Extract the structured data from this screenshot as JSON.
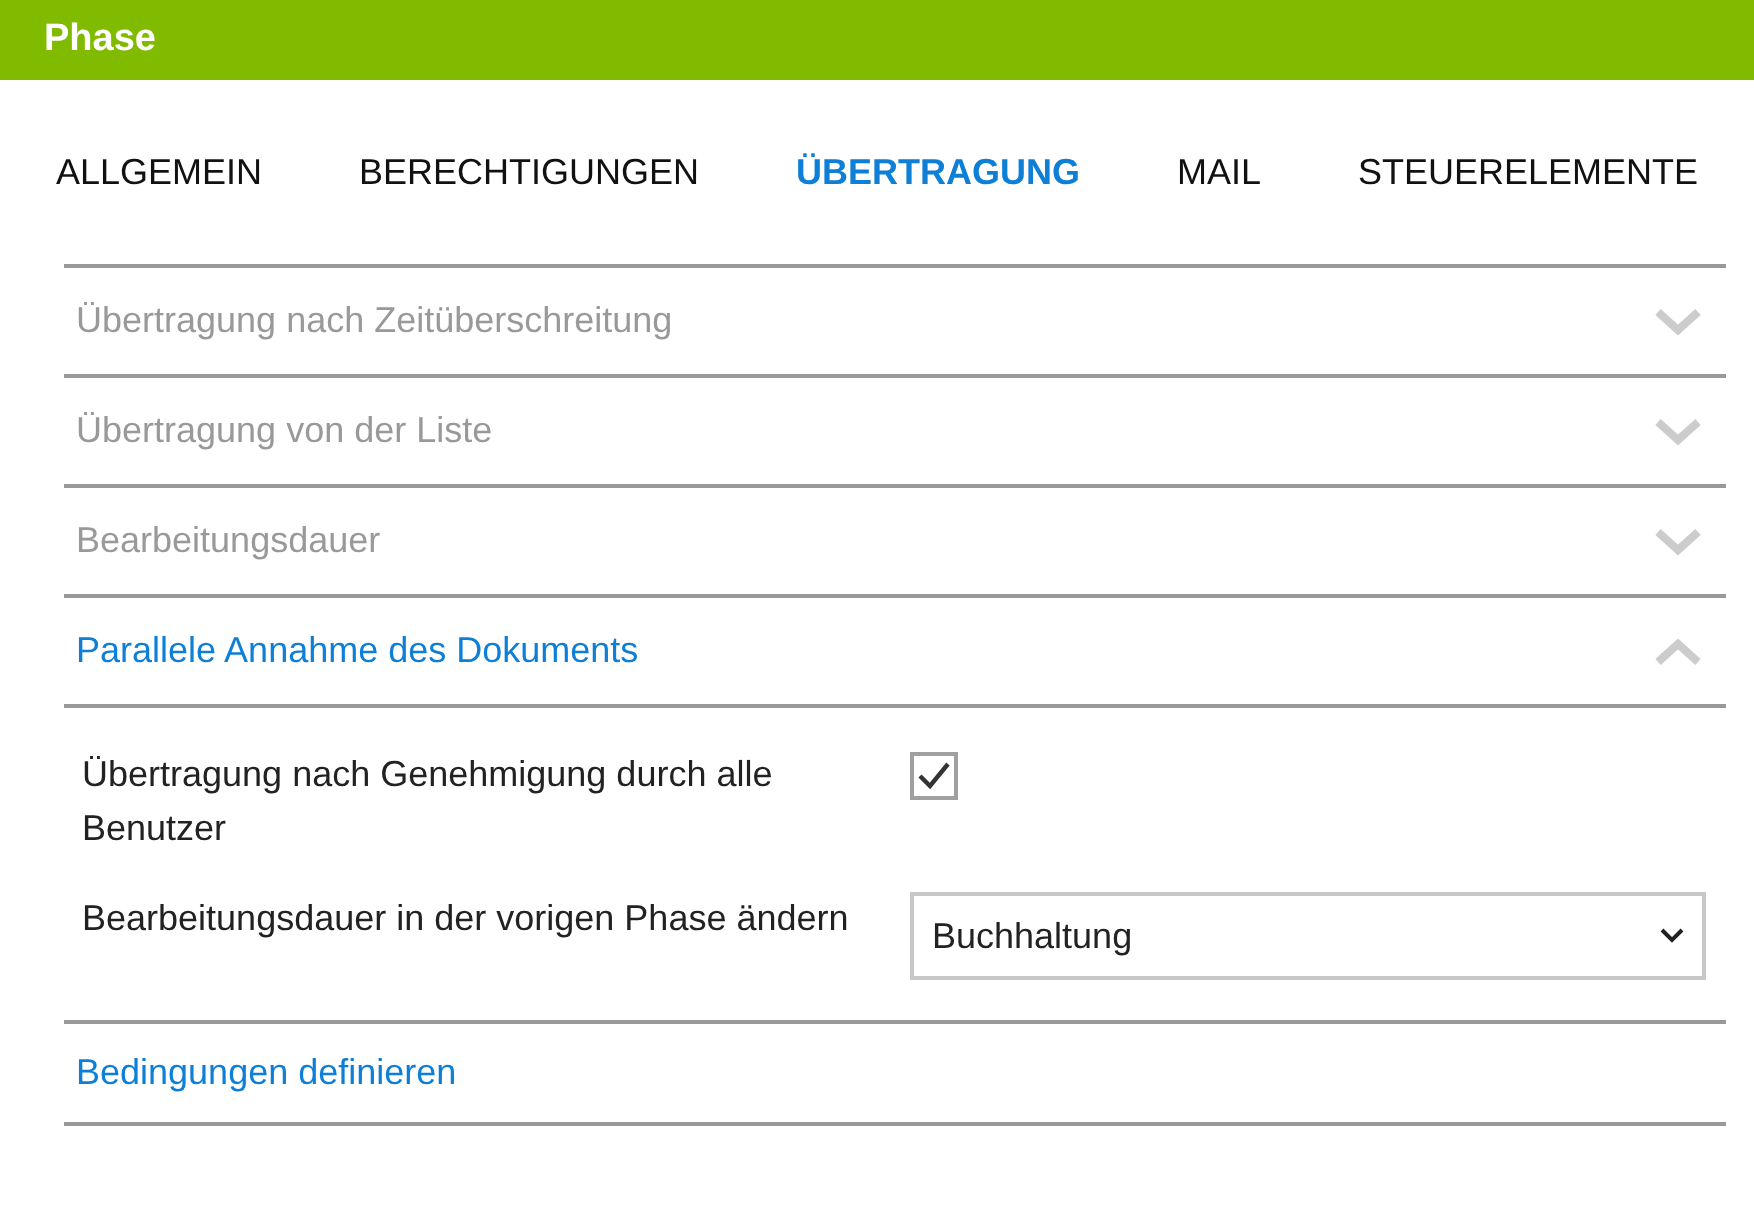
{
  "window": {
    "title": "Phase"
  },
  "tabs": [
    {
      "label": "ALLGEMEIN",
      "selected": false
    },
    {
      "label": "BERECHTIGUNGEN",
      "selected": false
    },
    {
      "label": "ÜBERTRAGUNG",
      "selected": true
    },
    {
      "label": "MAIL",
      "selected": false
    },
    {
      "label": "STEUERELEMENTE",
      "selected": false
    }
  ],
  "sections": [
    {
      "kind": "accordion",
      "title": "Übertragung nach Zeitüberschreitung",
      "expanded": false
    },
    {
      "kind": "accordion",
      "title": "Übertragung von der Liste",
      "expanded": false
    },
    {
      "kind": "accordion",
      "title": "Bearbeitungsdauer",
      "expanded": false
    },
    {
      "kind": "accordion",
      "title": "Parallele Annahme des Dokuments",
      "expanded": true,
      "fields": [
        {
          "kind": "checkbox",
          "label": "Übertragung nach Genehmigung durch alle Benutzer",
          "checked": true
        },
        {
          "kind": "select",
          "label": "Bearbeitungsdauer in der vorigen Phase ändern",
          "value": "Buchhaltung"
        }
      ]
    },
    {
      "kind": "link",
      "title": "Bedingungen definieren"
    }
  ]
}
